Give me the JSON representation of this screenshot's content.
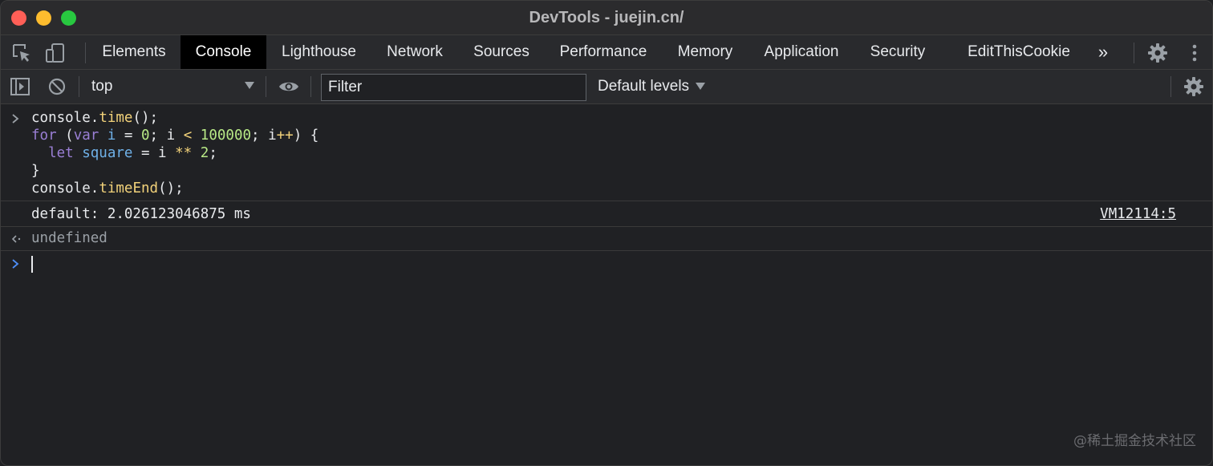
{
  "window": {
    "title": "DevTools - juejin.cn/"
  },
  "tabs": [
    {
      "label": "Elements"
    },
    {
      "label": "Console"
    },
    {
      "label": "Lighthouse"
    },
    {
      "label": "Network"
    },
    {
      "label": "Sources"
    },
    {
      "label": "Performance"
    },
    {
      "label": "Memory"
    },
    {
      "label": "Application"
    },
    {
      "label": "Security"
    },
    {
      "label": "EditThisCookie"
    }
  ],
  "active_tab": "Console",
  "overflow_label": "»",
  "console_toolbar": {
    "context": "top",
    "filter_placeholder": "Filter",
    "levels": "Default levels"
  },
  "console": {
    "input_code": {
      "line1": {
        "obj": "console",
        "dot": ".",
        "fn": "time",
        "rest": "();"
      },
      "line2": {
        "kw": "for",
        "p1": " (",
        "kw2": "var",
        "sp": " ",
        "v": "i",
        "eq": " = ",
        "n0": "0",
        "semi": "; i ",
        "lt": "<",
        "sp2": " ",
        "n1": "100000",
        "rest": "; i",
        "inc": "++",
        "close": ") {"
      },
      "line3": {
        "indent": "  ",
        "kw": "let",
        "sp": " ",
        "v": "square",
        "eq": " = i ",
        "op": "**",
        "sp2": " ",
        "n": "2",
        "semi": ";"
      },
      "line4": "}",
      "line5": {
        "obj": "console",
        "dot": ".",
        "fn": "timeEnd",
        "rest": "();"
      }
    },
    "log_message": "default: 2.026123046875 ms",
    "log_source": "VM12114:5",
    "result": "undefined"
  },
  "watermark": "@稀土掘金技术社区",
  "colors": {
    "background": "#202124",
    "toolbar": "#292a2d",
    "keyword": "#9a7fd5",
    "function": "#f2d27a",
    "variable": "#6fb1e8",
    "number": "#b8e986",
    "prompt_active": "#4e8ef7"
  },
  "icons": [
    "inspect-element-icon",
    "device-toggle-icon",
    "sidebar-toggle-icon",
    "clear-console-icon",
    "live-expression-eye-icon",
    "settings-gear-icon",
    "more-vertical-icon",
    "console-settings-gear-icon"
  ]
}
